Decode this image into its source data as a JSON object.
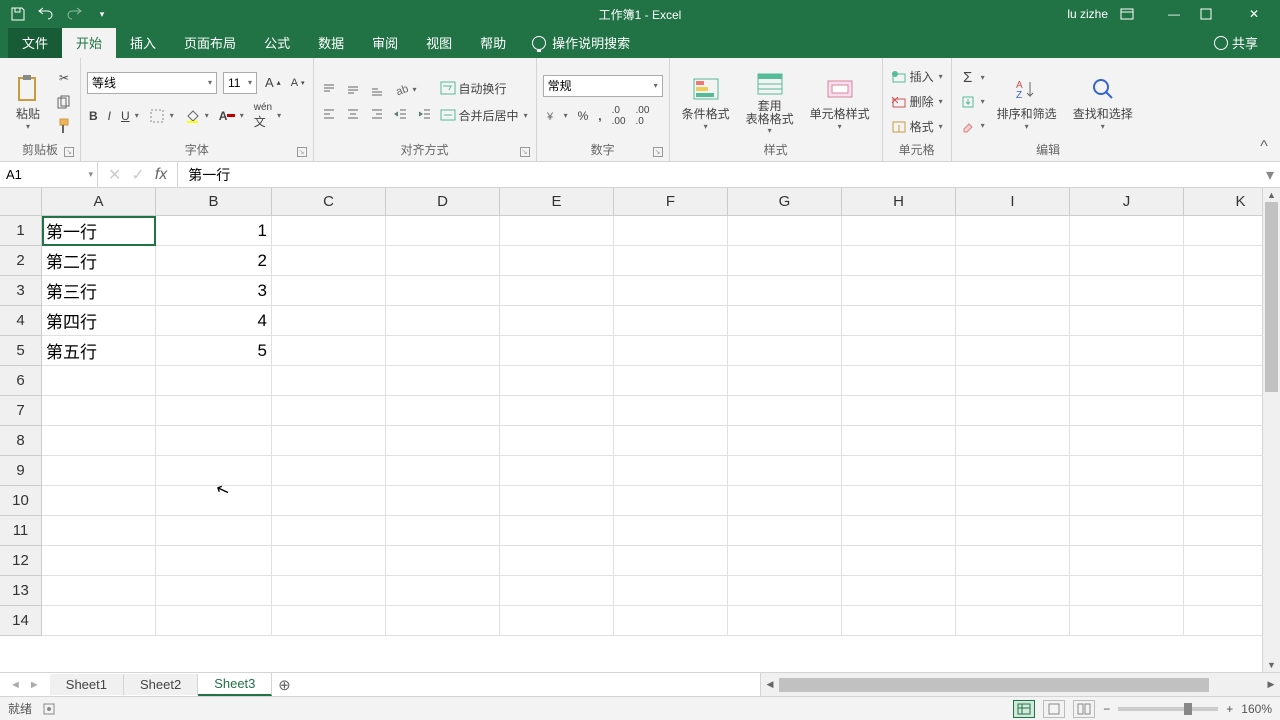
{
  "titlebar": {
    "title": "工作簿1 - Excel",
    "user": "lu zizhe"
  },
  "tabs": {
    "file": "文件",
    "items": [
      "开始",
      "插入",
      "页面布局",
      "公式",
      "数据",
      "审阅",
      "视图",
      "帮助"
    ],
    "active": "开始",
    "search": "操作说明搜索",
    "share": "共享"
  },
  "ribbon": {
    "clipboard": {
      "label": "剪贴板",
      "paste": "粘贴"
    },
    "font": {
      "label": "字体",
      "name": "等线",
      "size": "11"
    },
    "align": {
      "label": "对齐方式",
      "wrap": "自动换行",
      "merge": "合并后居中"
    },
    "number": {
      "label": "数字",
      "format": "常规"
    },
    "styles": {
      "label": "样式",
      "cond": "条件格式",
      "table": "套用\n表格格式",
      "cell": "单元格样式"
    },
    "cells": {
      "label": "单元格",
      "insert": "插入",
      "delete": "删除",
      "format": "格式"
    },
    "editing": {
      "label": "编辑",
      "sort": "排序和筛选",
      "find": "查找和选择"
    }
  },
  "namebox": "A1",
  "formula": "第一行",
  "columns": [
    "A",
    "B",
    "C",
    "D",
    "E",
    "F",
    "G",
    "H",
    "I",
    "J",
    "K"
  ],
  "rows": [
    1,
    2,
    3,
    4,
    5,
    6,
    7,
    8,
    9,
    10,
    11,
    12,
    13,
    14
  ],
  "data": {
    "A": [
      "第一行",
      "第二行",
      "第三行",
      "第四行",
      "第五行"
    ],
    "B": [
      "1",
      "2",
      "3",
      "4",
      "5"
    ]
  },
  "sheets": {
    "items": [
      "Sheet1",
      "Sheet2",
      "Sheet3"
    ],
    "active": "Sheet3"
  },
  "statusbar": {
    "ready": "就绪",
    "zoom": "160%"
  }
}
